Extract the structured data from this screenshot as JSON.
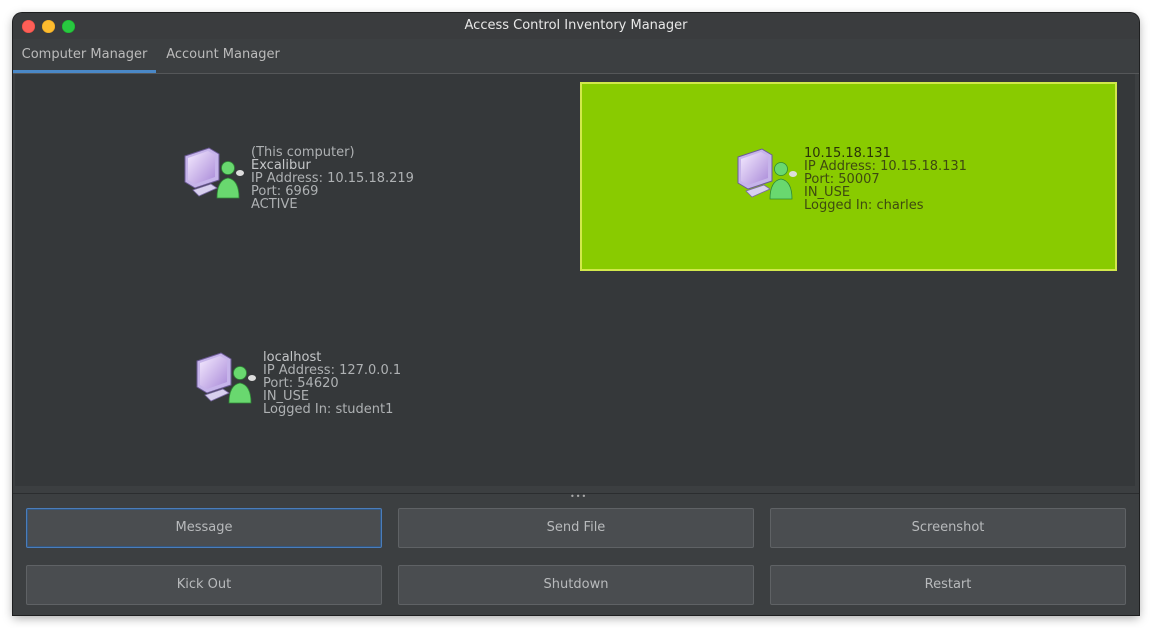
{
  "window": {
    "title": "Access Control Inventory Manager"
  },
  "tabs": [
    {
      "label": "Computer Manager",
      "selected": true
    },
    {
      "label": "Account Manager",
      "selected": false
    }
  ],
  "computers": [
    {
      "header": "(This computer)",
      "name": "Excalibur",
      "ip": "IP Address: 10.15.18.219",
      "port": "Port: 6969",
      "status": "ACTIVE",
      "icon": "computer-user-icon"
    },
    {
      "name": "10.15.18.131",
      "ip": "IP Address: 10.15.18.131",
      "port": "Port: 50007",
      "status": "IN_USE",
      "logged_in": "Logged In: charles",
      "selected": true,
      "highlight_color": "#89cb00",
      "icon": "computer-user-icon"
    },
    {
      "name": "localhost",
      "ip": "IP Address: 127.0.0.1",
      "port": "Port: 54620",
      "status": "IN_USE",
      "logged_in": "Logged In: student1",
      "icon": "computer-user-icon"
    }
  ],
  "actions": {
    "message": "Message",
    "send_file": "Send File",
    "screenshot": "Screenshot",
    "kick_out": "Kick Out",
    "shutdown": "Shutdown",
    "restart": "Restart"
  },
  "colors": {
    "window_bg": "#3c3f41",
    "tab_accent": "#4a88c7",
    "selected_node": "#89cb00",
    "close": "#fe5f57",
    "minimize": "#febc2e",
    "maximize": "#28c840"
  }
}
